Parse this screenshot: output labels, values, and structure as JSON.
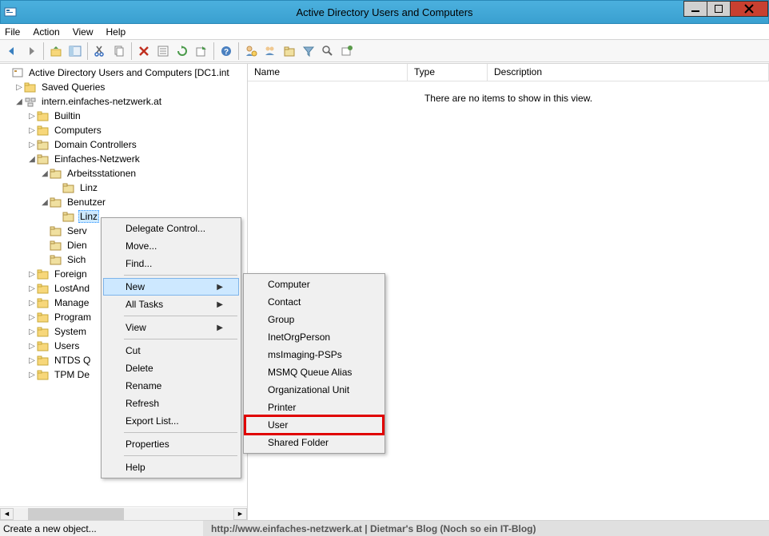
{
  "window": {
    "title": "Active Directory Users and Computers"
  },
  "menu": {
    "file": "File",
    "action": "Action",
    "view": "View",
    "help": "Help"
  },
  "tree": {
    "root": "Active Directory Users and Computers [DC1.int",
    "saved_queries": "Saved Queries",
    "domain": "intern.einfaches-netzwerk.at",
    "builtin": "Builtin",
    "computers": "Computers",
    "dc": "Domain Controllers",
    "en": "Einfaches-Netzwerk",
    "arbeit": "Arbeitsstationen",
    "linz1": "Linz",
    "benutzer": "Benutzer",
    "linz2": "Linz",
    "serv": "Serv",
    "dien": "Dien",
    "sich": "Sich",
    "foreign": "Foreign",
    "lostand": "LostAnd",
    "managed": "Manage",
    "program": "Program",
    "system": "System",
    "users": "Users",
    "ntdsq": "NTDS Q",
    "tpmde": "TPM De"
  },
  "list": {
    "col_name": "Name",
    "col_type": "Type",
    "col_desc": "Description",
    "empty": "There are no items to show in this view."
  },
  "ctx1": {
    "delegate": "Delegate Control...",
    "move": "Move...",
    "find": "Find...",
    "new": "New",
    "alltasks": "All Tasks",
    "view": "View",
    "cut": "Cut",
    "delete": "Delete",
    "rename": "Rename",
    "refresh": "Refresh",
    "export": "Export List...",
    "properties": "Properties",
    "help": "Help"
  },
  "ctx2": {
    "computer": "Computer",
    "contact": "Contact",
    "group": "Group",
    "inetorg": "InetOrgPerson",
    "msimaging": "msImaging-PSPs",
    "msmq": "MSMQ Queue Alias",
    "ou": "Organizational Unit",
    "printer": "Printer",
    "user": "User",
    "shared": "Shared Folder"
  },
  "status": {
    "left": "Create a new object...",
    "right": "http://www.einfaches-netzwerk.at | Dietmar's Blog (Noch so ein IT-Blog)"
  }
}
